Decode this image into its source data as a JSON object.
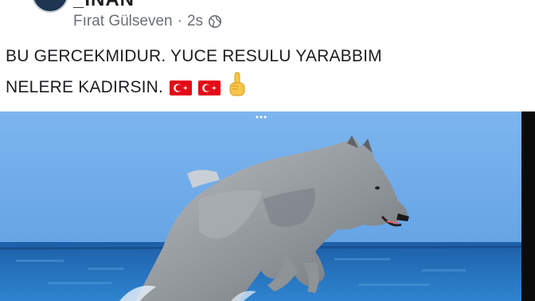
{
  "post": {
    "group_name": "_İNAN",
    "author": "Fırat Gülseven",
    "separator": "·",
    "time": "2s",
    "audience_icon": "globe-icon",
    "text_line1": "BU GERCEKMIDUR. YUCE RESULU YARABBIM",
    "text_line2": "NELERE KADIRSIN.",
    "emojis": [
      "turkey-flag",
      "turkey-flag",
      "index-pointing-up"
    ]
  },
  "image": {
    "subject": "wolf-leaping-from-sea",
    "colors": {
      "sky": "#6aa7e6",
      "sea": "#1f6bb5",
      "wolf": "#9a9ea3",
      "frame_right": "#0b0b0b"
    }
  },
  "colors": {
    "text": "#1c1e21",
    "meta": "#6b6f75",
    "flag_red": "#e30a17"
  }
}
